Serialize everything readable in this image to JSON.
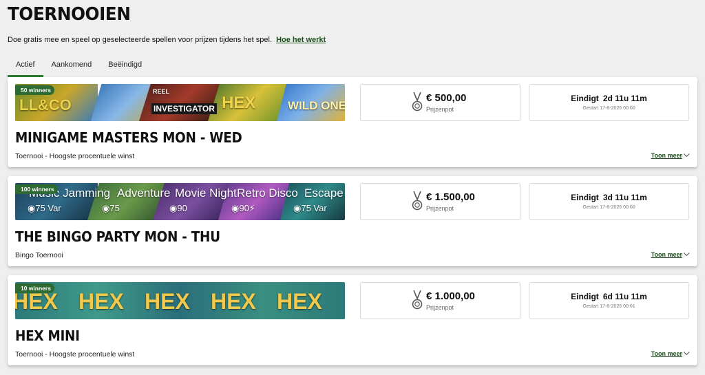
{
  "page": {
    "title": "TOERNOOIEN",
    "intro": "Doe gratis mee en speel op geselecteerde spellen voor prijzen tijdens het spel.",
    "how_link": "Hoe het werkt"
  },
  "tabs": [
    {
      "label": "Actief",
      "active": true
    },
    {
      "label": "Aankomend",
      "active": false
    },
    {
      "label": "Beëindigd",
      "active": false
    }
  ],
  "tournaments": [
    {
      "winners": "50 winners",
      "banner_texts": [
        "LL&CO",
        "REEL",
        "INVESTIGATOR",
        "HEX",
        "WILD ONE"
      ],
      "prize": "€ 500,00",
      "prize_label": "Prijzenpot",
      "ends_label": "Eindigt",
      "ends_time": "2d 11u 11m",
      "started": "Gestart 17-8-2026 00:00",
      "title": "MINIGAME MASTERS MON - WED",
      "subtitle": "Toernooi - Hoogste procentuele winst",
      "more": "Toon meer"
    },
    {
      "winners": "100 winners",
      "banner_texts": [
        "Music Jamming",
        "Adventure",
        "Movie Night",
        "Retro Disco",
        "Escape"
      ],
      "banner_sub": [
        "◉75 Var",
        "◉75",
        "◉90",
        "◉90⚡",
        "◉75 Var"
      ],
      "prize": "€ 1.500,00",
      "prize_label": "Prijzenpot",
      "ends_label": "Eindigt",
      "ends_time": "3d 11u 11m",
      "started": "Gestart 17-8-2026 00:00",
      "title": "THE BINGO PARTY MON - THU",
      "subtitle": "Bingo Toernooi",
      "more": "Toon meer"
    },
    {
      "winners": "10 winners",
      "banner_texts": [
        "HEX",
        "HEX",
        "HEX",
        "HEX",
        "HEX"
      ],
      "prize": "€ 1.000,00",
      "prize_label": "Prijzenpot",
      "ends_label": "Eindigt",
      "ends_time": "6d 11u 11m",
      "started": "Gestart 17-8-2026 00:01",
      "title": "HEX MINI",
      "subtitle": "Toernooi - Hoogste procentuele winst",
      "more": "Toon meer"
    }
  ],
  "colors": {
    "accent": "#2f7d32",
    "badge": "#2e6b33",
    "link": "#1c4d1c"
  }
}
